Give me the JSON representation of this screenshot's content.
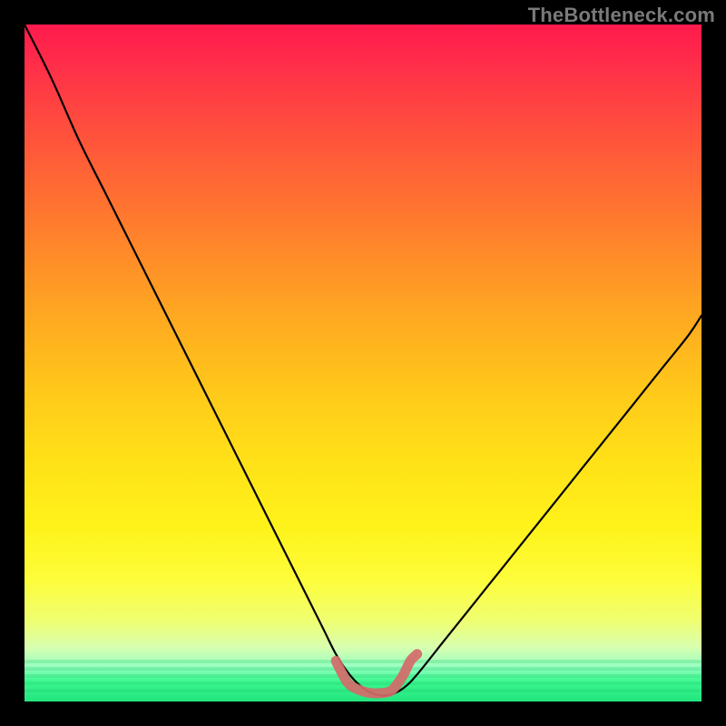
{
  "watermark": {
    "text": "TheBottleneck.com"
  },
  "chart_data": {
    "type": "line",
    "title": "",
    "xlabel": "",
    "ylabel": "",
    "xlim": [
      0,
      100
    ],
    "ylim": [
      0,
      100
    ],
    "grid": false,
    "legend": false,
    "background": "rainbow-gradient-vertical",
    "series": [
      {
        "name": "bottleneck-curve",
        "stroke": "#000000",
        "x": [
          0,
          4,
          8,
          12,
          16,
          20,
          24,
          28,
          32,
          36,
          40,
          44,
          46,
          48,
          50,
          52,
          54,
          56,
          58,
          62,
          66,
          70,
          74,
          78,
          82,
          86,
          90,
          94,
          98,
          100
        ],
        "y": [
          100,
          92,
          83,
          75,
          67,
          59,
          51,
          43,
          35,
          27,
          19,
          11,
          7,
          4,
          2,
          1,
          1,
          2,
          4,
          9,
          14,
          19,
          24,
          29,
          34,
          39,
          44,
          49,
          54,
          57
        ]
      },
      {
        "name": "optimal-zone-marker",
        "stroke": "#d46a6a",
        "thick": true,
        "x": [
          46,
          47,
          48,
          50,
          52,
          54,
          55,
          56,
          57,
          58
        ],
        "y": [
          6,
          4,
          2.5,
          1.5,
          1.2,
          1.5,
          2.5,
          4,
          6,
          7
        ]
      }
    ],
    "notes": "V-shaped bottleneck curve; minimum (optimal) near x≈52. Left branch steeper than right. Values are read off the plot in percent of axis range."
  }
}
